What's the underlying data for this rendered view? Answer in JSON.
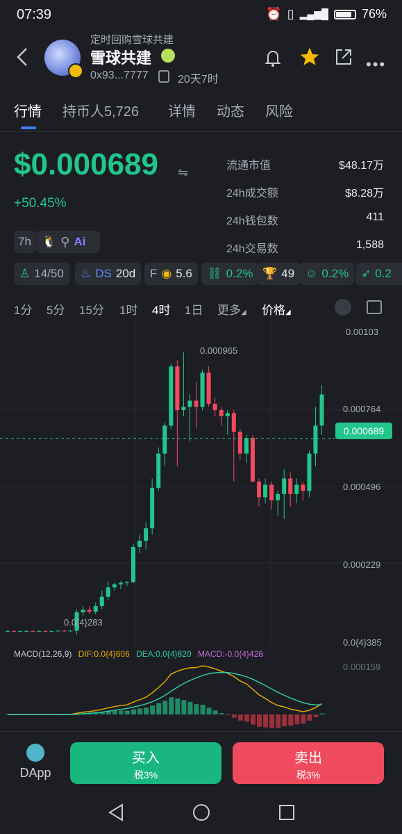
{
  "status_bar": {
    "time": "07:39",
    "battery": "76%"
  },
  "header": {
    "subtitle": "定时回购雪球共建",
    "title": "雪球共建",
    "address": "0x93...7777",
    "age": "20天7时"
  },
  "tabs": [
    {
      "label": "行情"
    },
    {
      "label": "持币人5,726"
    },
    {
      "label": "详情"
    },
    {
      "label": "动态"
    },
    {
      "label": "风险"
    }
  ],
  "price": {
    "value": "$0.000689",
    "change": "+50.45%"
  },
  "stats": [
    {
      "label": "流通市值",
      "value": "$48.17万"
    },
    {
      "label": "24h成交额",
      "value": "$8.28万"
    },
    {
      "label": "24h钱包数",
      "value": "411"
    },
    {
      "label": "24h交易数",
      "value": "1,588"
    }
  ],
  "tag_row": {
    "age": "7h",
    "ai": "Ai"
  },
  "metrics": {
    "holders": "14/50",
    "ds_label": "DS",
    "ds_value": "20d",
    "f_label": "F",
    "f_value": "5.6",
    "tax1": "0.2%",
    "trophy": "49",
    "tax2": "0.2%",
    "tax3": "0.2"
  },
  "intervals": [
    "1分",
    "5分",
    "15分",
    "1时",
    "4时",
    "1日",
    "更多",
    "价格"
  ],
  "active_interval": "4时",
  "chart_labels": {
    "y_ticks": [
      "0.00103",
      "0.000764",
      "0.000496",
      "0.000229",
      "0.0{4}385"
    ],
    "current_price": "0.000689",
    "high_label": "0.000965",
    "low_label": "0.0{4}283",
    "macd_header": "MACD(12,26,9)",
    "dif": "DIF:0.0{4}606",
    "dea": "DEA:0.0{4}820",
    "macd": "MACD:-0.0{4}428",
    "macd_tick": "0.000159"
  },
  "colors": {
    "up": "#22c58b",
    "down": "#f2495e",
    "dif": "#e0a800",
    "dea": "#2fc9a5",
    "macd": "#c86ad8"
  },
  "chart_data": {
    "type": "candlestick",
    "ylim": [
      3.85e-05,
      0.00103
    ],
    "candles": [
      [
        7e-05,
        7.2e-05,
        6.8e-05,
        7e-05
      ],
      [
        7e-05,
        7.2e-05,
        6.8e-05,
        6.9e-05
      ],
      [
        6.9e-05,
        7.1e-05,
        6.8e-05,
        7e-05
      ],
      [
        7e-05,
        7.2e-05,
        6.9e-05,
        7e-05
      ],
      [
        7e-05,
        7.2e-05,
        6.8e-05,
        6.9e-05
      ],
      [
        6.9e-05,
        7.1e-05,
        6.7e-05,
        7e-05
      ],
      [
        7e-05,
        7.2e-05,
        6.8e-05,
        6.9e-05
      ],
      [
        6.9e-05,
        7.2e-05,
        6.8e-05,
        7e-05
      ],
      [
        7e-05,
        7.2e-05,
        6.9e-05,
        7.1e-05
      ],
      [
        7.1e-05,
        7.3e-05,
        6.9e-05,
        7e-05
      ],
      [
        7e-05,
        7.2e-05,
        6.8e-05,
        7.1e-05
      ],
      [
        7.1e-05,
        0.00014,
        6e-05,
        0.00013
      ],
      [
        0.00013,
        0.00015,
        0.00012,
        0.000138
      ],
      [
        0.000138,
        0.00015,
        0.000125,
        0.000132
      ],
      [
        0.000132,
        0.00016,
        0.000125,
        0.00015
      ],
      [
        0.00015,
        0.0002,
        0.00014,
        0.00018
      ],
      [
        0.00018,
        0.00023,
        0.00017,
        0.00021
      ],
      [
        0.00021,
        0.000225,
        0.0002,
        0.00022
      ],
      [
        0.00022,
        0.00023,
        0.000205,
        0.000225
      ],
      [
        0.000225,
        0.00023,
        0.000215,
        0.000227
      ],
      [
        0.000227,
        0.00035,
        0.000225,
        0.00034
      ],
      [
        0.00034,
        0.00038,
        0.00032,
        0.00036
      ],
      [
        0.00036,
        0.00042,
        0.00033,
        0.0004
      ],
      [
        0.0004,
        0.00056,
        0.00038,
        0.00053
      ],
      [
        0.00053,
        0.00066,
        0.00052,
        0.00064
      ],
      [
        0.00064,
        0.00074,
        0.0006,
        0.00073
      ],
      [
        0.00073,
        0.00093,
        0.00072,
        0.00092
      ],
      [
        0.00092,
        0.00094,
        0.0006,
        0.00078
      ],
      [
        0.00078,
        0.000965,
        0.00076,
        0.00079
      ],
      [
        0.00079,
        0.00083,
        0.00068,
        0.00081
      ],
      [
        0.00081,
        0.00087,
        0.00072,
        0.00079
      ],
      [
        0.00079,
        0.00091,
        0.00078,
        0.0009
      ],
      [
        0.0009,
        0.00092,
        0.00079,
        0.0008
      ],
      [
        0.0008,
        0.00082,
        0.00076,
        0.00078
      ],
      [
        0.00078,
        0.00079,
        0.00073,
        0.00076
      ],
      [
        0.00076,
        0.00078,
        0.0007,
        0.00077
      ],
      [
        0.00077,
        0.00078,
        0.00055,
        0.00071
      ],
      [
        0.00071,
        0.00072,
        0.00062,
        0.00064
      ],
      [
        0.00064,
        0.0007,
        0.00061,
        0.00069
      ],
      [
        0.00069,
        0.0007,
        0.0006,
        0.00055
      ],
      [
        0.00055,
        0.00056,
        0.00047,
        0.0005
      ],
      [
        0.0005,
        0.00056,
        0.00048,
        0.00054
      ],
      [
        0.00054,
        0.00055,
        0.00046,
        0.00049
      ],
      [
        0.00049,
        0.00052,
        0.00044,
        0.00051
      ],
      [
        0.00051,
        0.00059,
        0.00043,
        0.00056
      ],
      [
        0.00056,
        0.00058,
        0.00047,
        0.00051
      ],
      [
        0.00051,
        0.00056,
        0.00048,
        0.00054
      ],
      [
        0.00054,
        0.00055,
        0.00049,
        0.00052
      ],
      [
        0.00052,
        0.00065,
        0.0005,
        0.00064
      ],
      [
        0.00064,
        0.00079,
        0.0006,
        0.00073
      ],
      [
        0.00073,
        0.00086,
        0.0007,
        0.00083
      ]
    ]
  }
}
